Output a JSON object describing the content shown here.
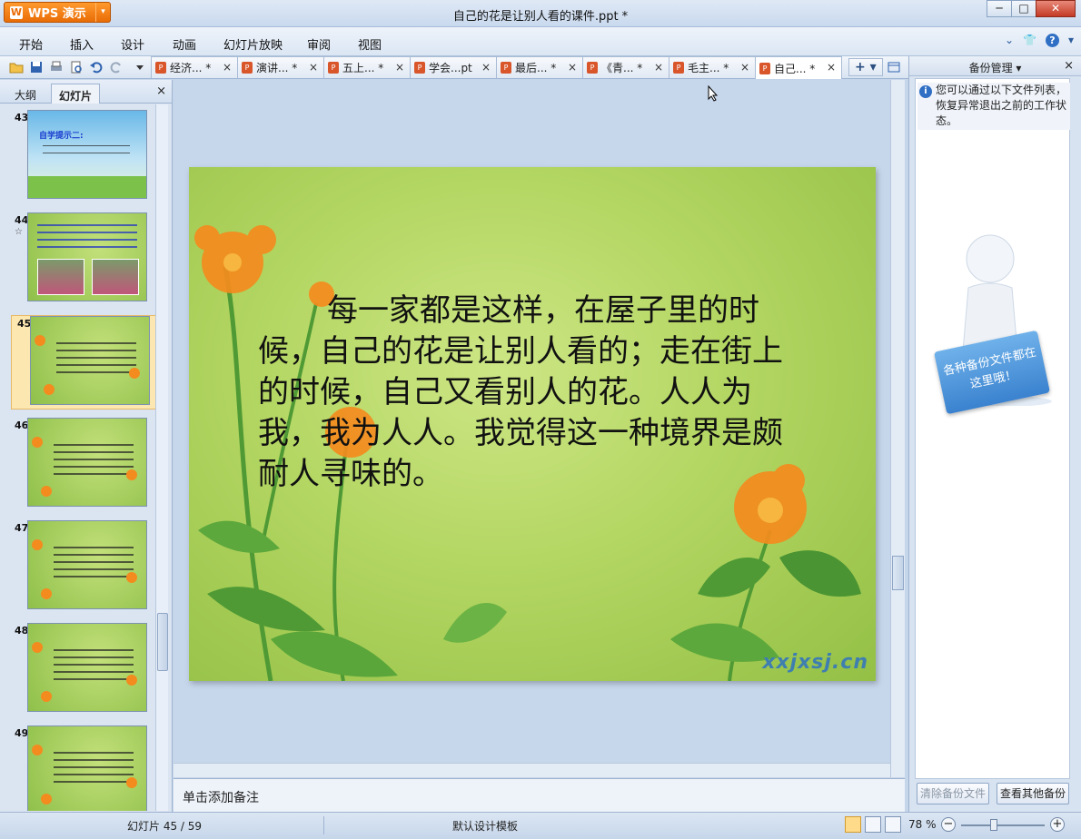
{
  "app": {
    "name": "WPS 演示",
    "logo_glyph": "W"
  },
  "window": {
    "title": "自己的花是让别人看的课件.ppt *",
    "minimize": "─",
    "maximize": "□",
    "close": "✕"
  },
  "menu": {
    "items": [
      "开始",
      "插入",
      "设计",
      "动画",
      "幻灯片放映",
      "审阅",
      "视图"
    ]
  },
  "tabs": [
    {
      "label": "经济... *",
      "active": false
    },
    {
      "label": "演讲... *",
      "active": false
    },
    {
      "label": "五上... *",
      "active": false
    },
    {
      "label": "学会...pt",
      "active": false
    },
    {
      "label": "最后... *",
      "active": false
    },
    {
      "label": "《青... *",
      "active": false
    },
    {
      "label": "毛主... *",
      "active": false
    },
    {
      "label": "自己... *",
      "active": true
    }
  ],
  "tab_close": "×",
  "tab_add": "+ ▾",
  "left_panel": {
    "tab_outline": "大纲",
    "tab_slides": "幻灯片",
    "close": "×",
    "thumbnails": [
      {
        "number": "43",
        "title": "自学提示二:",
        "style": "sky",
        "selected": false,
        "star": ""
      },
      {
        "number": "44",
        "title": "",
        "style": "green-photos",
        "selected": false,
        "star": "☆"
      },
      {
        "number": "45",
        "title": "",
        "style": "green",
        "selected": true,
        "star": ""
      },
      {
        "number": "46",
        "title": "",
        "style": "green",
        "selected": false,
        "star": ""
      },
      {
        "number": "47",
        "title": "",
        "style": "green",
        "selected": false,
        "star": ""
      },
      {
        "number": "48",
        "title": "",
        "style": "green",
        "selected": false,
        "star": ""
      },
      {
        "number": "49",
        "title": "",
        "style": "green",
        "selected": false,
        "star": ""
      }
    ]
  },
  "slide": {
    "text": "每一家都是这样，在屋子里的时候，自己的花是让别人看的；走在街上的时候，自己又看别人的花。人人为我，我为人人。我觉得这一种境界是颇耐人寻味的。",
    "watermark": "xxjxsj.cn"
  },
  "notes": {
    "placeholder": "单击添加备注"
  },
  "right_panel": {
    "title": "备份管理 ▾",
    "close": "×",
    "info": "您可以通过以下文件列表，恢复异常退出之前的工作状态。",
    "sign_text": "各种备份文件都在这里哦！",
    "btn_clear": "清除备份文件",
    "btn_view": "查看其他备份"
  },
  "status": {
    "slide_counter": "幻灯片 45 / 59",
    "template": "默认设计模板",
    "zoom": "78 %",
    "zoom_minus": "−",
    "zoom_plus": "+",
    "zoom_fraction": 0.78
  },
  "colors": {
    "accent": "#e96c06",
    "slide_bg": "#b3d662",
    "flower": "#f48b1e"
  }
}
